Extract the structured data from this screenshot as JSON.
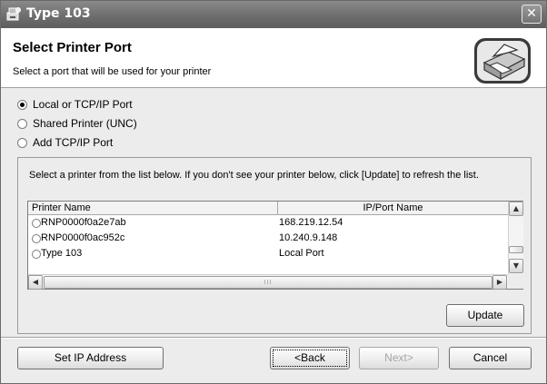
{
  "window": {
    "title": "Type 103",
    "close_glyph": "✕"
  },
  "header": {
    "title": "Select Printer Port",
    "subtitle": "Select a port that will be used for your printer",
    "icon": "printer-icon"
  },
  "port_options": [
    {
      "label": "Local or TCP/IP Port",
      "selected": true
    },
    {
      "label": "Shared Printer (UNC)",
      "selected": false
    },
    {
      "label": "Add TCP/IP Port",
      "selected": false
    }
  ],
  "printer_list": {
    "note": "Select a printer from the list below. If you don't see your printer below, click [Update] to refresh the list.",
    "columns": [
      "Printer Name",
      "IP/Port Name"
    ],
    "rows": [
      {
        "name": "RNP0000f0a2e7ab",
        "port": "168.219.12.54"
      },
      {
        "name": "RNP0000f0ac952c",
        "port": "10.240.9.148"
      },
      {
        "name": "Type 103",
        "port": "Local Port"
      }
    ],
    "hscroll_grip": "III",
    "update_label": "Update"
  },
  "footer": {
    "set_ip_label": "Set IP Address",
    "back_label": "<Back",
    "next_label": "Next>",
    "cancel_label": "Cancel"
  },
  "colors": {
    "titlebar": "#6e6e6e",
    "dialog_bg": "#ececec",
    "header_bg": "#ffffff"
  }
}
